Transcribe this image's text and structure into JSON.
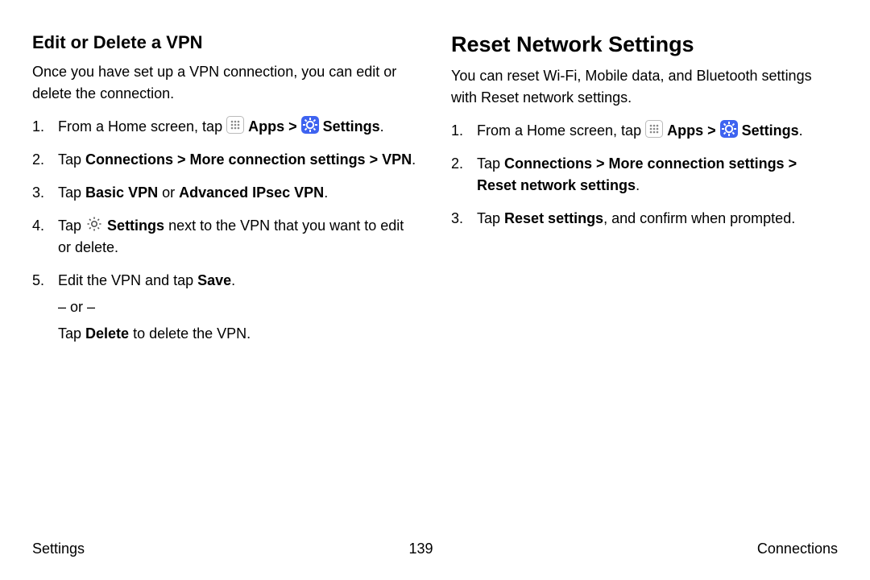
{
  "left": {
    "heading": "Edit or Delete a VPN",
    "intro": "Once you have set up a VPN connection, you can edit or delete the connection.",
    "s1": {
      "num": "1.",
      "pre": "From a Home screen, tap ",
      "apps": "Apps",
      "sep": " > ",
      "settings": "Settings",
      "end": "."
    },
    "s2": {
      "num": "2.",
      "pre": "Tap ",
      "path": "Connections > More connection settings > VPN",
      "end": "."
    },
    "s3": {
      "num": "3.",
      "pre": "Tap ",
      "a": "Basic VPN",
      "or": " or ",
      "b": "Advanced IPsec VPN",
      "end": "."
    },
    "s4": {
      "num": "4.",
      "pre": "Tap ",
      "settings": "Settings",
      "post": " next to the VPN that you want to edit or delete."
    },
    "s5": {
      "num": "5.",
      "pre": "Edit the VPN and tap ",
      "save": "Save",
      "end": ".",
      "or_line": "– or –",
      "del_pre": "Tap ",
      "del": "Delete",
      "del_post": " to delete the VPN."
    }
  },
  "right": {
    "heading": "Reset Network Settings",
    "intro": "You can reset Wi-Fi, Mobile data, and Bluetooth settings with Reset network settings.",
    "s1": {
      "num": "1.",
      "pre": "From a Home screen, tap ",
      "apps": "Apps",
      "sep": " > ",
      "settings": "Settings",
      "end": "."
    },
    "s2": {
      "num": "2.",
      "pre": "Tap ",
      "path": "Connections > More connection settings > Reset network settings",
      "end": "."
    },
    "s3": {
      "num": "3.",
      "pre": "Tap ",
      "reset": "Reset settings",
      "post": ", and confirm when prompted."
    }
  },
  "footer": {
    "left": "Settings",
    "center": "139",
    "right": "Connections"
  }
}
